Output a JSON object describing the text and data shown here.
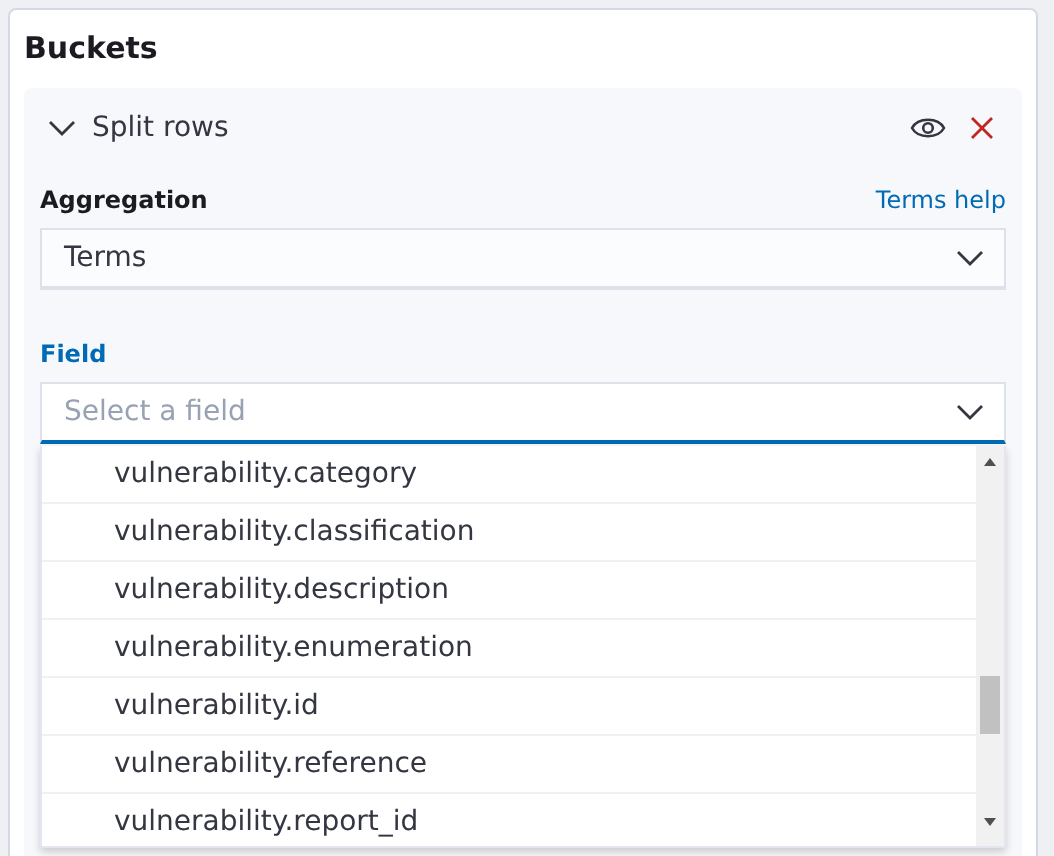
{
  "section": {
    "title": "Buckets"
  },
  "bucket": {
    "title": "Split rows",
    "expanded": true
  },
  "aggregation": {
    "label": "Aggregation",
    "help_link": "Terms help",
    "value": "Terms"
  },
  "field": {
    "label": "Field",
    "placeholder": "Select a field",
    "focused": true
  },
  "options": [
    {
      "label": "vulnerability.category"
    },
    {
      "label": "vulnerability.classification"
    },
    {
      "label": "vulnerability.description"
    },
    {
      "label": "vulnerability.enumeration"
    },
    {
      "label": "vulnerability.id"
    },
    {
      "label": "vulnerability.reference"
    },
    {
      "label": "vulnerability.report_id"
    }
  ]
}
